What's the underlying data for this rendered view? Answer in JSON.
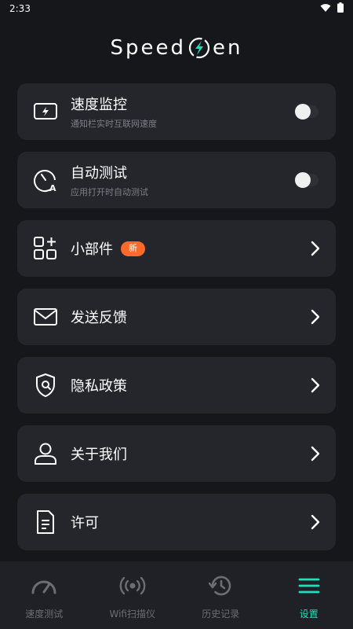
{
  "status_bar": {
    "time": "2:33",
    "icons": [
      "wifi-icon",
      "battery-icon"
    ]
  },
  "app": {
    "logo_left": "Speed",
    "logo_right": "en",
    "logo_icon": "lightning-bolt-icon"
  },
  "settings": [
    {
      "title": "速度监控",
      "subtitle": "通知栏实时互联网速度",
      "icon": "monitor-icon",
      "control": "toggle",
      "toggle_on": false
    },
    {
      "title": "自动测试",
      "subtitle": "应用打开时自动测试",
      "icon": "auto-test-gauge-icon",
      "control": "toggle",
      "toggle_on": false
    },
    {
      "title": "小部件",
      "badge": "新",
      "icon": "widgets-icon",
      "control": "chevron"
    },
    {
      "title": "发送反馈",
      "icon": "mail-icon",
      "control": "chevron"
    },
    {
      "title": "隐私政策",
      "icon": "privacy-shield-icon",
      "control": "chevron"
    },
    {
      "title": "关于我们",
      "icon": "person-icon",
      "control": "chevron"
    },
    {
      "title": "许可",
      "icon": "document-icon",
      "control": "chevron"
    }
  ],
  "bottom_nav": {
    "items": [
      {
        "label": "速度测试",
        "icon": "speedometer-icon",
        "active": false
      },
      {
        "label": "Wifi扫描仪",
        "icon": "wifi-scan-icon",
        "active": false
      },
      {
        "label": "历史记录",
        "icon": "history-icon",
        "active": false
      },
      {
        "label": "设置",
        "icon": "menu-icon",
        "active": true
      }
    ]
  },
  "colors": {
    "background": "#16171b",
    "card": "#25262c",
    "accent": "#1fe0b8",
    "badge": "#ff6a2b",
    "muted_text": "#7d7f86"
  }
}
